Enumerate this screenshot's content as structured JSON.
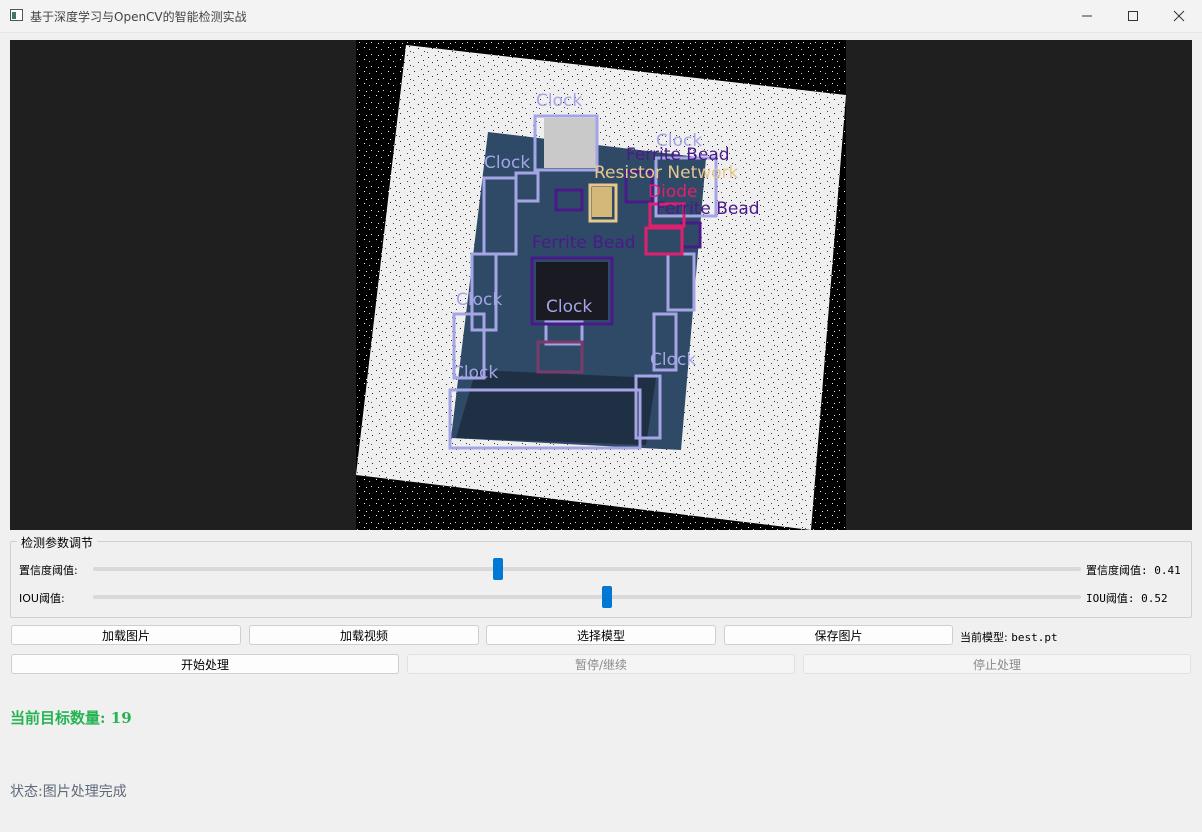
{
  "window": {
    "title": "基于深度学习与OpenCV的智能检测实战"
  },
  "detections": {
    "labels": [
      "Clock",
      "Clock",
      "Clock",
      "Ferrite Bead",
      "Resistor Network",
      "Diode",
      "Ferrite Bead",
      "Ferrite Bead",
      "Clock",
      "Clock",
      "Clock",
      "Clock"
    ],
    "colors": {
      "Clock": "#a5a5e6",
      "Ferrite Bead": "#4b1a8a",
      "Resistor Network": "#e6c88a",
      "Diode": "#e0206e"
    }
  },
  "params": {
    "group_title": "检测参数调节",
    "confidence": {
      "label": "置信度阈值:",
      "value_text": "置信度阈值: 0.41",
      "value": 0.41
    },
    "iou": {
      "label": "IOU阈值:",
      "value_text": "IOU阈值: 0.52",
      "value": 0.52
    }
  },
  "toolbar": {
    "load_image": "加载图片",
    "load_video": "加载视频",
    "select_model": "选择模型",
    "save_image": "保存图片",
    "current_model_label": "当前模型:",
    "current_model_value": "best.pt",
    "start": "开始处理",
    "pause": "暂停/继续",
    "stop": "停止处理"
  },
  "info": {
    "count_label": "当前目标数量:",
    "count_value": "19",
    "status_label": "状态:",
    "status_value": "图片处理完成"
  }
}
